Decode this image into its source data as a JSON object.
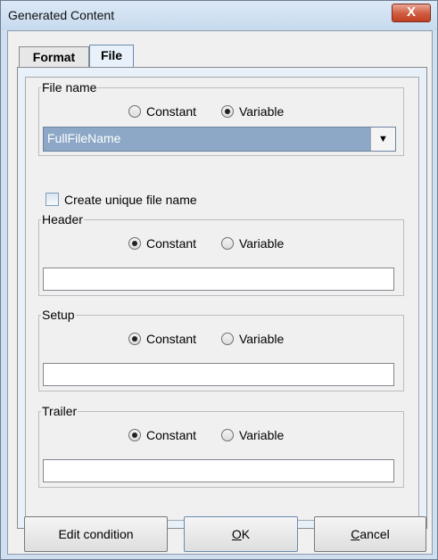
{
  "window": {
    "title": "Generated Content",
    "close_glyph": "X"
  },
  "tabs": [
    {
      "label": "Format",
      "active": false
    },
    {
      "label": "File",
      "active": true
    }
  ],
  "file_name": {
    "legend": "File name",
    "options": [
      "Constant",
      "Variable"
    ],
    "selected": "Variable",
    "combo_value": "FullFileName"
  },
  "unique": {
    "label": "Create unique file name",
    "checked": false
  },
  "header": {
    "legend": "Header",
    "options": [
      "Constant",
      "Variable"
    ],
    "selected": "Constant",
    "value": ""
  },
  "setup": {
    "legend": "Setup",
    "options": [
      "Constant",
      "Variable"
    ],
    "selected": "Constant",
    "value": ""
  },
  "trailer": {
    "legend": "Trailer",
    "options": [
      "Constant",
      "Variable"
    ],
    "selected": "Constant",
    "value": ""
  },
  "buttons": {
    "edit": "Edit condition",
    "ok_mnemonic": "O",
    "ok_rest": "K",
    "cancel_mnemonic": "C",
    "cancel_rest": "ancel"
  },
  "icons": {
    "combo_arrow": "chevron-down-icon",
    "close": "close-icon"
  }
}
